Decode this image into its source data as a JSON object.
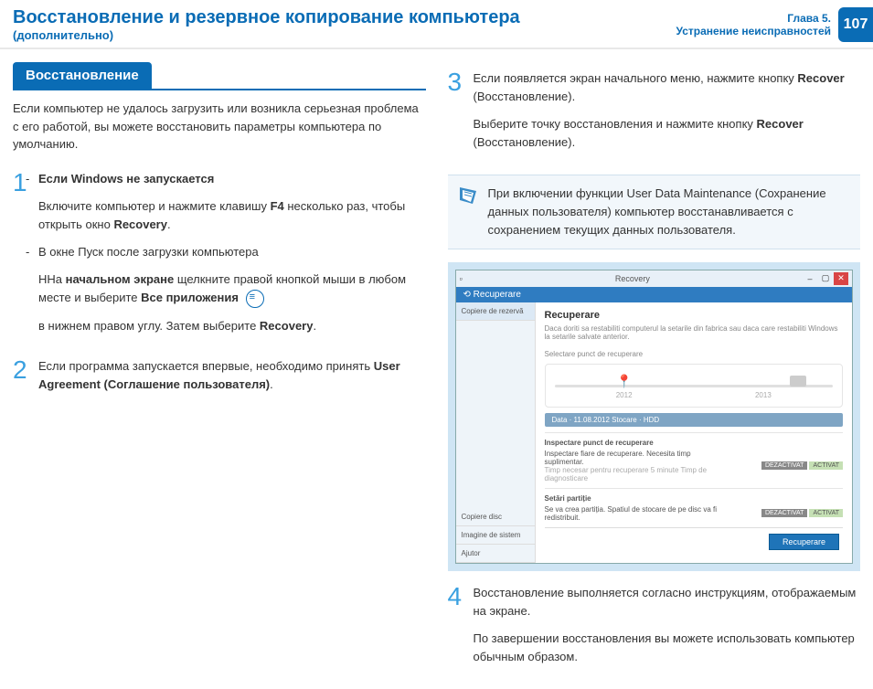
{
  "header": {
    "title": "Восстановление и резервное копирование компьютера",
    "subtitle": "(дополнительно)",
    "chapter": "Глава 5.",
    "chapter2": "Устранение неисправностей",
    "page": "107"
  },
  "section": {
    "tag": "Восстановление",
    "intro": "Если компьютер не удалось загрузить или возникла серьезная проблема с его работой, вы можете восстановить параметры компьютера по умолчанию."
  },
  "steps": {
    "s1a_t": "Если Windows не запускается",
    "s1a_b1": "Включите компьютер и нажмите клавишу ",
    "s1a_f4": "F4",
    "s1a_b2": " несколько раз, чтобы открыть окно ",
    "s1a_rec": "Recovery",
    "s1a_b3": ".",
    "s1b_t": "В окне Пуск после загрузки компьютера",
    "s1b_b1": "HНа ",
    "s1b_b2": "начальном экране",
    "s1b_b3": " щелкните правой кнопкой мыши в любом месте и выберите ",
    "s1b_b4": "Все приложения",
    "s1b_b5": "в нижнем правом углу. Затем выберите ",
    "s1b_rec": "Recovery",
    "s1b_b6": ".",
    "s2": "Если программа запускается впервые, необходимо принять ",
    "s2b": "User Agreement (Соглашение пользователя)",
    "s2c": ".",
    "s3a": "Если появляется экран начального меню, нажмите кнопку ",
    "s3rec": "Recover",
    "s3a2": " (Восстановление).",
    "s3b": "Выберите точку восстановления и нажмите кнопку ",
    "s3b2": " (Восстановление).",
    "note": "При включении функции User Data Maintenance (Сохранение данных пользователя) компьютер восстанавливается с сохранением текущих данных пользователя.",
    "s4a": "Восстановление выполняется согласно инструкциям, отображаемым на экране.",
    "s4b": "По завершении восстановления вы можете использовать компьютер обычным образом."
  },
  "nums": {
    "n1": "1",
    "n2": "2",
    "n3": "3",
    "n4": "4"
  },
  "win": {
    "app": "Recovery",
    "tab": "Recuperare",
    "side_active": "Copiere de rezervă",
    "side_b1": "Copiere disc",
    "side_b2": "Imagine de sistem",
    "side_b3": "Ajutor",
    "heading": "Recuperare",
    "desc": "Daca doriti sa restabiliti computerul la setarile din fabrica sau daca care restabiliti Windows la setarile salvate anterior.",
    "sel": "Selectare punct de recuperare",
    "y1": "2012",
    "y2": "2013",
    "info": "Data · 11.08.2012    Stocare · HDD",
    "opt_h": "Inspectare punct de recuperare",
    "opt1": "Inspectare fiare de recuperare. Necesita timp suplimentar.",
    "opt1b": "Timp necesar pentru recuperare 5 minute   Timp de diagnosticare",
    "off": "DEZACTIVAT",
    "on": "ACTIVAT",
    "part_h": "Setări partiție",
    "part": "Se va crea partiția. Spatiul de stocare de pe disc va fi redistribuit.",
    "btn": "Recuperare"
  }
}
